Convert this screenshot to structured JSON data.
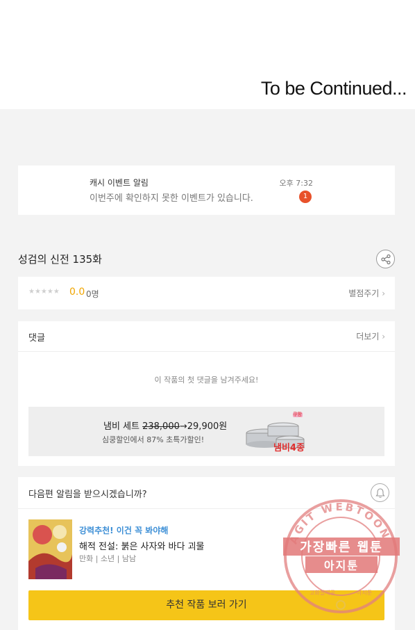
{
  "banner": {
    "text": "To be Continued..."
  },
  "notice": {
    "title": "캐시 이벤트 알림",
    "message": "이번주에 확인하지 못한 이벤트가 있습니다.",
    "time": "오후 7:32",
    "badge": "1",
    "badge_color": "#e8512a"
  },
  "episode": {
    "title": "성검의 신전 135화",
    "share_icon": "share-icon"
  },
  "rating": {
    "stars": "★★★★★",
    "score": "0.0",
    "count": "0명",
    "rate_link": "별점주기",
    "stars_filled": 0,
    "accent": "#f0a500"
  },
  "comments": {
    "title": "댓글",
    "more": "더보기",
    "empty": "이 작품의 첫 댓글을 남겨주세요!"
  },
  "ad": {
    "title_prefix": "냄비 세트 ",
    "old_price": "238,000",
    "arrow_price": "→29,900원",
    "subtitle": "심쿵할인에서 87% 초특가할인!",
    "tag": "냄비4종",
    "badge": "쿠팡"
  },
  "next": {
    "question": "다음편 알림을 받으시겠습니까?",
    "bell_icon": "bell-icon",
    "rec_label": "강력추천! 이건 꼭 봐야해",
    "rec_title": "해적 전설: 붉은 사자와 바다 괴물",
    "rec_genre": "만화 | 소년 | 남남",
    "cta": "추천 작품 보러 가기",
    "cta_color": "#f5c518"
  },
  "watermark": {
    "ring_text": "AGIT WEBTOON",
    "line1": "가장빠른 웹툰",
    "line2": "아지툰",
    "sub_left": "고화질제공",
    "sub_right": "아지툰"
  }
}
